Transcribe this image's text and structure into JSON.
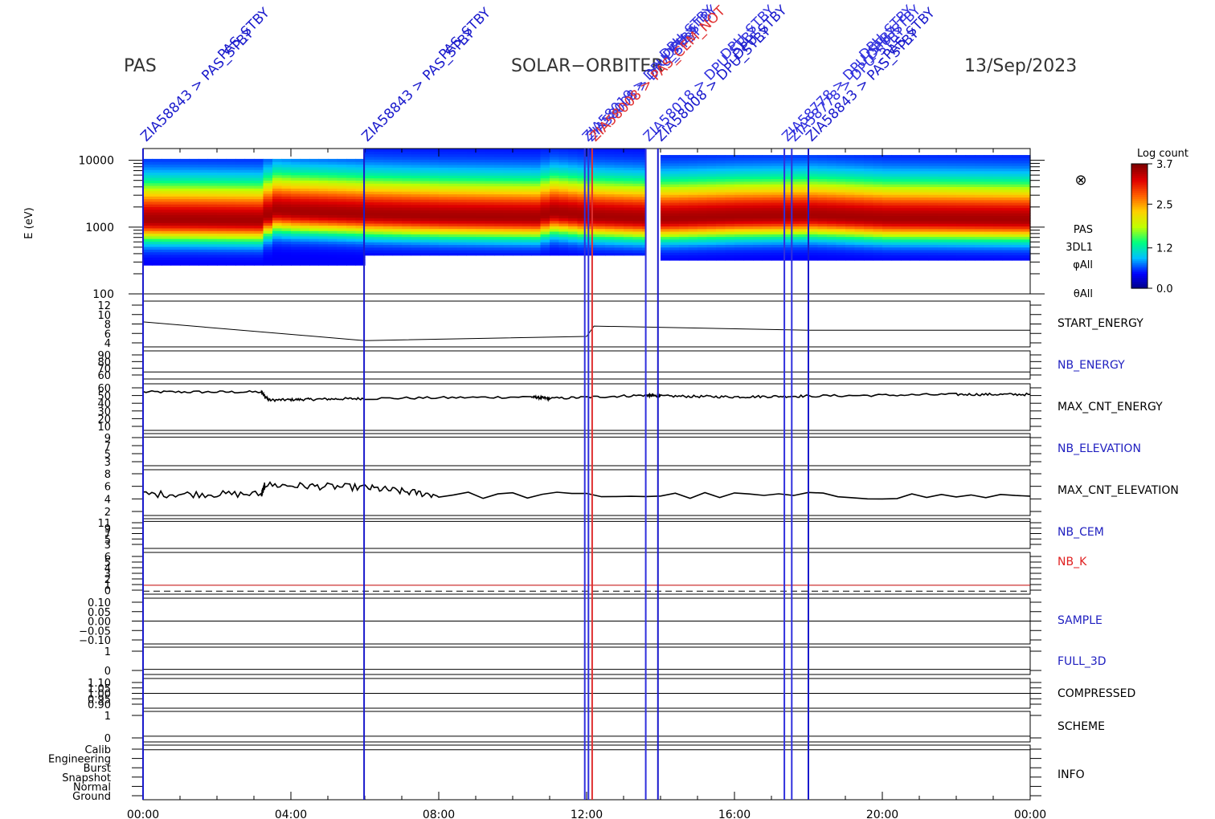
{
  "header": {
    "instrument": "PAS",
    "mission": "SOLAR−ORBITER",
    "date": "13/Sep/2023"
  },
  "chart_data": {
    "type": "heatmap",
    "time_axis": {
      "tick_labels": [
        "00:00",
        "04:00",
        "08:00",
        "12:00",
        "16:00",
        "20:00",
        "00:00"
      ],
      "range_hours": [
        0,
        24
      ]
    },
    "spectrogram": {
      "ylabel": "E (eV)",
      "yscale": "log",
      "ylim": [
        100,
        15000
      ],
      "y_ticks": [
        "10000",
        "1000",
        "100"
      ],
      "side_labels": [
        "PAS",
        "3DL1",
        "φAll",
        "θAll"
      ],
      "sun_symbol": "⊗",
      "colorbar": {
        "title": "Log count",
        "tick_labels": [
          "3.7",
          "2.5",
          "1.2",
          "0.0"
        ],
        "range": [
          0,
          3.7
        ],
        "colors": [
          "#000080",
          "#0000ff",
          "#00c0ff",
          "#00ff80",
          "#c0ff00",
          "#ffd000",
          "#ff6000",
          "#e00000",
          "#800000"
        ]
      },
      "peak_energy_ev": [
        {
          "t": 0.0,
          "v": 1300
        },
        {
          "t": 3.2,
          "v": 1250
        },
        {
          "t": 3.3,
          "v": 1800
        },
        {
          "t": 4.0,
          "v": 1700
        },
        {
          "t": 6.0,
          "v": 1550
        },
        {
          "t": 8.0,
          "v": 1450
        },
        {
          "t": 10.5,
          "v": 1400
        },
        {
          "t": 11.0,
          "v": 1650
        },
        {
          "t": 12.0,
          "v": 1450
        },
        {
          "t": 13.5,
          "v": 1350
        },
        {
          "t": 14.0,
          "v": 1350
        },
        {
          "t": 16.0,
          "v": 1450
        },
        {
          "t": 18.0,
          "v": 1500
        },
        {
          "t": 20.0,
          "v": 1350
        },
        {
          "t": 24.0,
          "v": 1300
        }
      ],
      "coverage": [
        {
          "from": 0.0,
          "to": 6.0,
          "e_low": 270,
          "e_high": 10500
        },
        {
          "from": 6.0,
          "to": 13.6,
          "e_low": 380,
          "e_high": 15000
        },
        {
          "from": 14.0,
          "to": 24.0,
          "e_low": 320,
          "e_high": 12000
        }
      ],
      "data_gap": [
        13.6,
        14.0
      ]
    },
    "panels": [
      {
        "label": "START_ENERGY",
        "label_color": "#000000",
        "tick_labels": [
          "12",
          "10",
          "8",
          "6",
          "4"
        ],
        "ylim": [
          2,
          13
        ],
        "series": [
          {
            "color": "#000000",
            "steps": [
              [
                0,
                8
              ],
              [
                6.0,
                3.5
              ],
              [
                12.0,
                4.5
              ],
              [
                12.2,
                7
              ],
              [
                18.0,
                6
              ],
              [
                24,
                6
              ]
            ]
          }
        ]
      },
      {
        "label": "NB_ENERGY",
        "label_color": "#2020c0",
        "tick_labels": [
          "90",
          "80",
          "70",
          "60"
        ],
        "ylim": [
          55,
          95
        ],
        "series": [
          {
            "color": "#000000",
            "steps": [
              [
                0,
                65
              ],
              [
                24,
                65
              ]
            ]
          }
        ]
      },
      {
        "label": "MAX_CNT_ENERGY",
        "label_color": "#000000",
        "tick_labels": [
          "60",
          "50",
          "40",
          "30",
          "20",
          "10"
        ],
        "ylim": [
          5,
          62
        ],
        "series": [
          {
            "color": "#000000",
            "noise": 1.5,
            "steps": [
              [
                0,
                52
              ],
              [
                3.2,
                52
              ],
              [
                3.4,
                42
              ],
              [
                4.5,
                43
              ],
              [
                6,
                44
              ],
              [
                10.5,
                46
              ],
              [
                11,
                44
              ],
              [
                13.6,
                48
              ],
              [
                14,
                47
              ],
              [
                16,
                46
              ],
              [
                18,
                47
              ],
              [
                22,
                49
              ],
              [
                24,
                49
              ]
            ]
          }
        ]
      },
      {
        "label": "NB_ELEVATION",
        "label_color": "#2020c0",
        "tick_labels": [
          "9",
          "7",
          "5",
          "3"
        ],
        "ylim": [
          1,
          10
        ],
        "series": [
          {
            "color": "#000000",
            "steps": [
              [
                0,
                9
              ],
              [
                24,
                9
              ]
            ]
          }
        ]
      },
      {
        "label": "MAX_CNT_ELEVATION",
        "label_color": "#000000",
        "tick_labels": [
          "8",
          "6",
          "4",
          "2"
        ],
        "ylim": [
          0,
          9
        ],
        "series": [
          {
            "color": "#000000",
            "noise": 0.7,
            "steps": [
              [
                0,
                4.2
              ],
              [
                3.2,
                4.2
              ],
              [
                3.3,
                6
              ],
              [
                6,
                5.5
              ],
              [
                8,
                4
              ],
              [
                24,
                3.8
              ]
            ]
          }
        ]
      },
      {
        "label": "NB_CEM",
        "label_color": "#2020c0",
        "tick_labels": [
          "11",
          "9",
          "7",
          "5",
          "3"
        ],
        "ylim": [
          1,
          12
        ],
        "series": [
          {
            "color": "#000000",
            "steps": [
              [
                0,
                11
              ],
              [
                24,
                11
              ]
            ]
          }
        ]
      },
      {
        "label": "NB_K",
        "label_color": "#e02020",
        "tick_labels": [
          "6",
          "5",
          "4",
          "3",
          "2",
          "1",
          "0"
        ],
        "ylim": [
          -0.5,
          6.5
        ],
        "series": [
          {
            "color": "#c00000",
            "steps": [
              [
                0,
                1
              ],
              [
                24,
                1
              ]
            ]
          },
          {
            "color": "#000000",
            "dashed": true,
            "steps": [
              [
                0,
                0
              ],
              [
                24,
                0
              ]
            ]
          }
        ]
      },
      {
        "label": "SAMPLE",
        "label_color": "#2020c0",
        "tick_labels": [
          "0.10",
          "0.05",
          "0.00",
          "−0.05",
          "−0.10"
        ],
        "ylim": [
          -0.12,
          0.12
        ],
        "series": [
          {
            "color": "#000000",
            "steps": [
              [
                0,
                0
              ],
              [
                24,
                0
              ]
            ]
          }
        ]
      },
      {
        "label": "FULL_3D",
        "label_color": "#2020c0",
        "tick_labels": [
          "1",
          "0"
        ],
        "ylim": [
          -0.3,
          1.3
        ],
        "series": [
          {
            "color": "#000000",
            "steps": [
              [
                0,
                0
              ],
              [
                24,
                0
              ]
            ]
          }
        ]
      },
      {
        "label": "COMPRESSED",
        "label_color": "#000000",
        "tick_labels": [
          "1.10",
          "1.05",
          "1.00",
          "0.95",
          "0.90"
        ],
        "ylim": [
          0.88,
          1.12
        ],
        "series": [
          {
            "color": "#000000",
            "steps": [
              [
                0,
                1.0
              ],
              [
                24,
                1.0
              ]
            ]
          }
        ]
      },
      {
        "label": "SCHEME",
        "label_color": "#000000",
        "tick_labels": [
          "1",
          "0"
        ],
        "ylim": [
          -0.3,
          1.3
        ],
        "series": [
          {
            "color": "#000000",
            "steps": [
              [
                0,
                0
              ],
              [
                24,
                0
              ]
            ]
          }
        ]
      },
      {
        "label": "INFO",
        "label_color": "#000000",
        "tick_labels": [
          "Calib",
          "Engineering",
          "Burst",
          "Snapshot",
          "Normal",
          "Ground"
        ],
        "ylim": [
          -0.5,
          5.5
        ],
        "series": [
          {
            "color": "#000000",
            "steps": [
              [
                0,
                5
              ],
              [
                24,
                5
              ]
            ]
          }
        ]
      }
    ],
    "event_markers": [
      {
        "t": 0.0,
        "color": "#1a1acc",
        "label": "ZIA58843 > PAS_STBY",
        "extra": [
          "PAS_STBY"
        ]
      },
      {
        "t": 5.98,
        "color": "#1a1acc",
        "label": "ZIA58843 > PAS_STBY",
        "extra": [
          "PAS_STBY"
        ]
      },
      {
        "t": 11.95,
        "color": "#3030dd",
        "label": "ZIA58019 > DPU_STBY",
        "extra": [
          "DPU_STBY"
        ]
      },
      {
        "t": 12.05,
        "color": "#3030dd",
        "label": "ZIA58008 > DPU_STBY",
        "extra": [
          "DPU_STBY"
        ]
      },
      {
        "t": 12.15,
        "color": "#e03030",
        "label": "ZIA58008 > PAS_CEM_NOT",
        "extra": []
      },
      {
        "t": 13.6,
        "color": "#3030dd",
        "label": "ZIA58018 > DPU_STBY",
        "extra": [
          "DPU_STBY"
        ]
      },
      {
        "t": 13.93,
        "color": "#1a1acc",
        "label": "ZIA58008 > DPU_STBY",
        "extra": [
          "DPU_STBY"
        ]
      },
      {
        "t": 17.35,
        "color": "#3030dd",
        "label": "ZIA58778 > DPU_STBY",
        "extra": [
          "DPU_STBY"
        ]
      },
      {
        "t": 17.55,
        "color": "#3030dd",
        "label": "ZIA58778 > DPU_STBY",
        "extra": [
          "DPU_STBY"
        ]
      },
      {
        "t": 18.0,
        "color": "#1a1acc",
        "label": "ZIA58843 > PAS_STBY",
        "extra": [
          "PAS_STBY"
        ]
      }
    ]
  }
}
